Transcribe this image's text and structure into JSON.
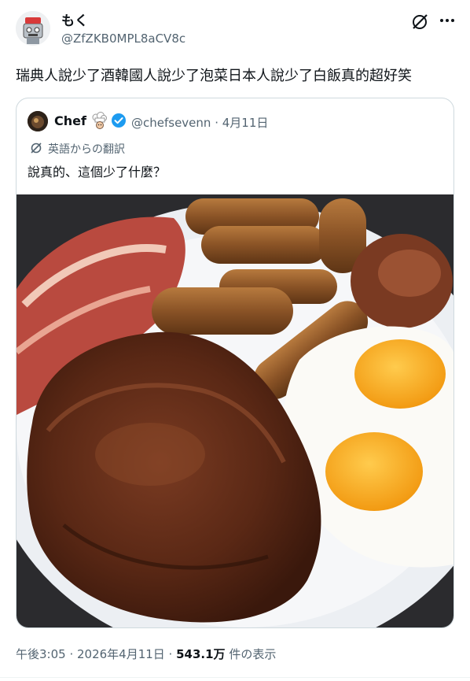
{
  "author": {
    "display_name": "もく",
    "handle": "@ZfZKB0MPL8aCV8c",
    "avatar_icon": "robot-chef-avatar"
  },
  "tweet": {
    "text": "瑞典人說少了酒韓國人說少了泡菜日本人說少了白飯真的超好笑"
  },
  "header_actions": {
    "grok_icon": "grok-icon",
    "more_icon": "more-icon"
  },
  "quoted": {
    "display_name": "Chef",
    "handle_date": "@chefsevenn · 4月11日",
    "verified_color": "#1d9bf0",
    "translate_label": "英語からの翻訳",
    "text": "說真的、這個少了什麼？",
    "image_icon": "breakfast-plate-image"
  },
  "meta": {
    "time_date": "午後3:05 · 2026年4月11日 · ",
    "views": "543.1万",
    "views_label": " 件の表示"
  },
  "colors": {
    "text_primary": "#0f1419",
    "text_secondary": "#536471",
    "border": "#cfd9de"
  }
}
